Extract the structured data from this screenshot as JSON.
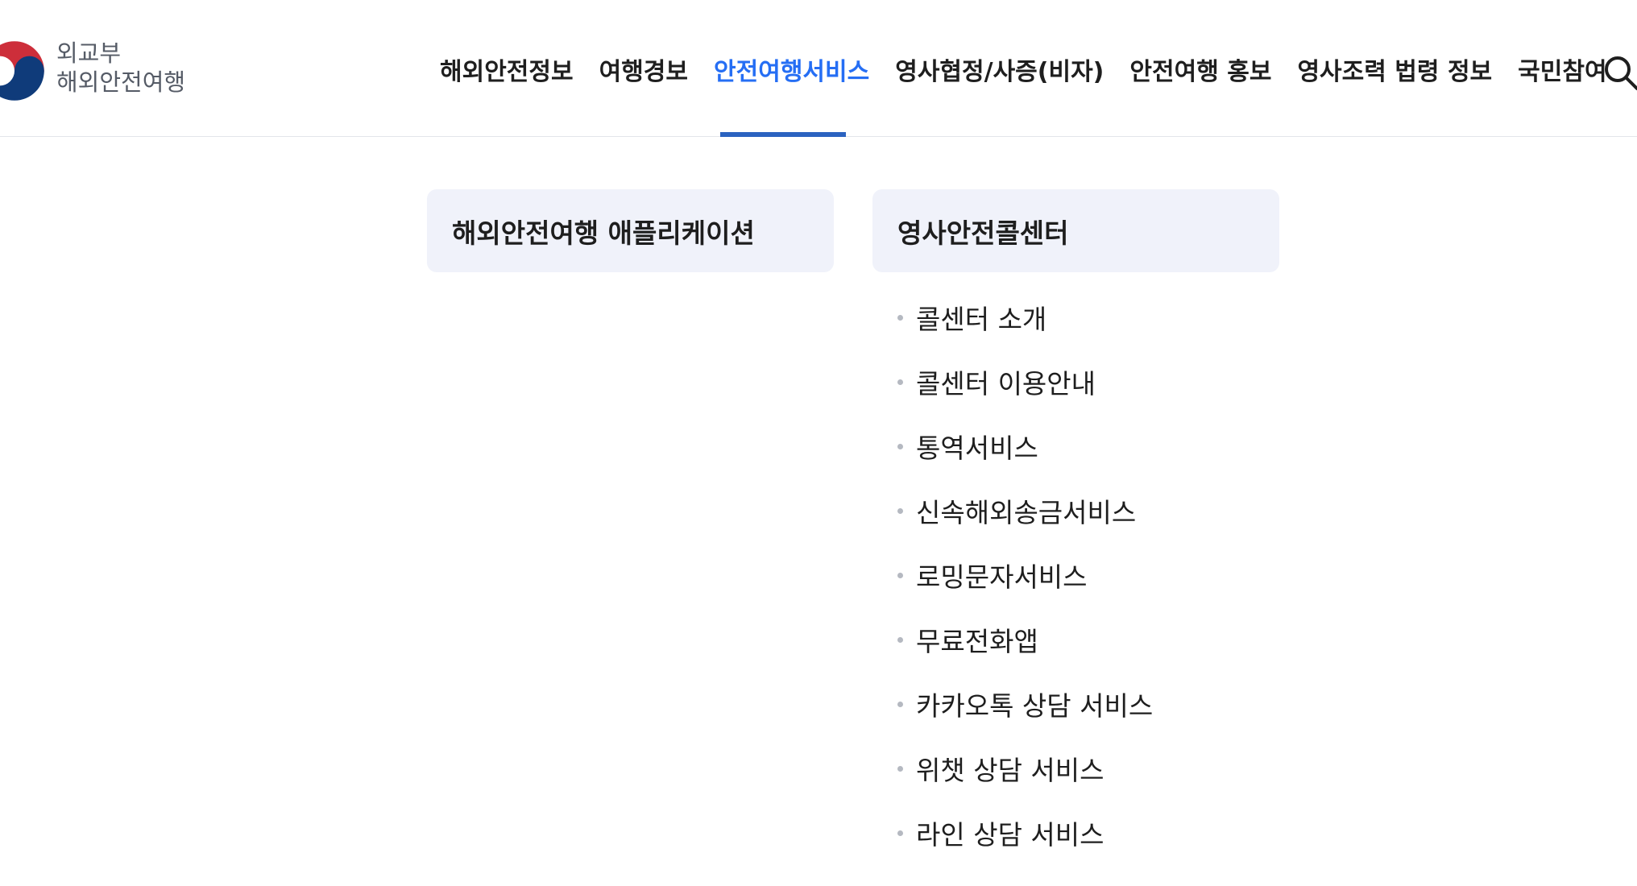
{
  "logo": {
    "line1": "외교부",
    "line2": "해외안전여행"
  },
  "nav": {
    "items": [
      {
        "label": "해외안전정보"
      },
      {
        "label": "여행경보"
      },
      {
        "label": "안전여행서비스"
      },
      {
        "label": "영사협정/사증(비자)"
      },
      {
        "label": "안전여행 홍보"
      },
      {
        "label": "영사조력 법령 정보"
      },
      {
        "label": "국민참여"
      }
    ],
    "active_label": "안전여행서비스",
    "accent_color": "#256ef4"
  },
  "submenu": {
    "left_title": "해외안전여행 애플리케이션",
    "right_title": "영사안전콜센터",
    "items": [
      {
        "label": "콜센터 소개"
      },
      {
        "label": "콜센터 이용안내"
      },
      {
        "label": "통역서비스"
      },
      {
        "label": "신속해외송금서비스"
      },
      {
        "label": "로밍문자서비스"
      },
      {
        "label": "무료전화앱"
      },
      {
        "label": "카카오톡 상담 서비스"
      },
      {
        "label": "위챗 상담 서비스"
      },
      {
        "label": "라인 상담 서비스"
      }
    ]
  },
  "icons": {
    "search": "search-icon",
    "emblem": "taegeuk-emblem-icon"
  }
}
